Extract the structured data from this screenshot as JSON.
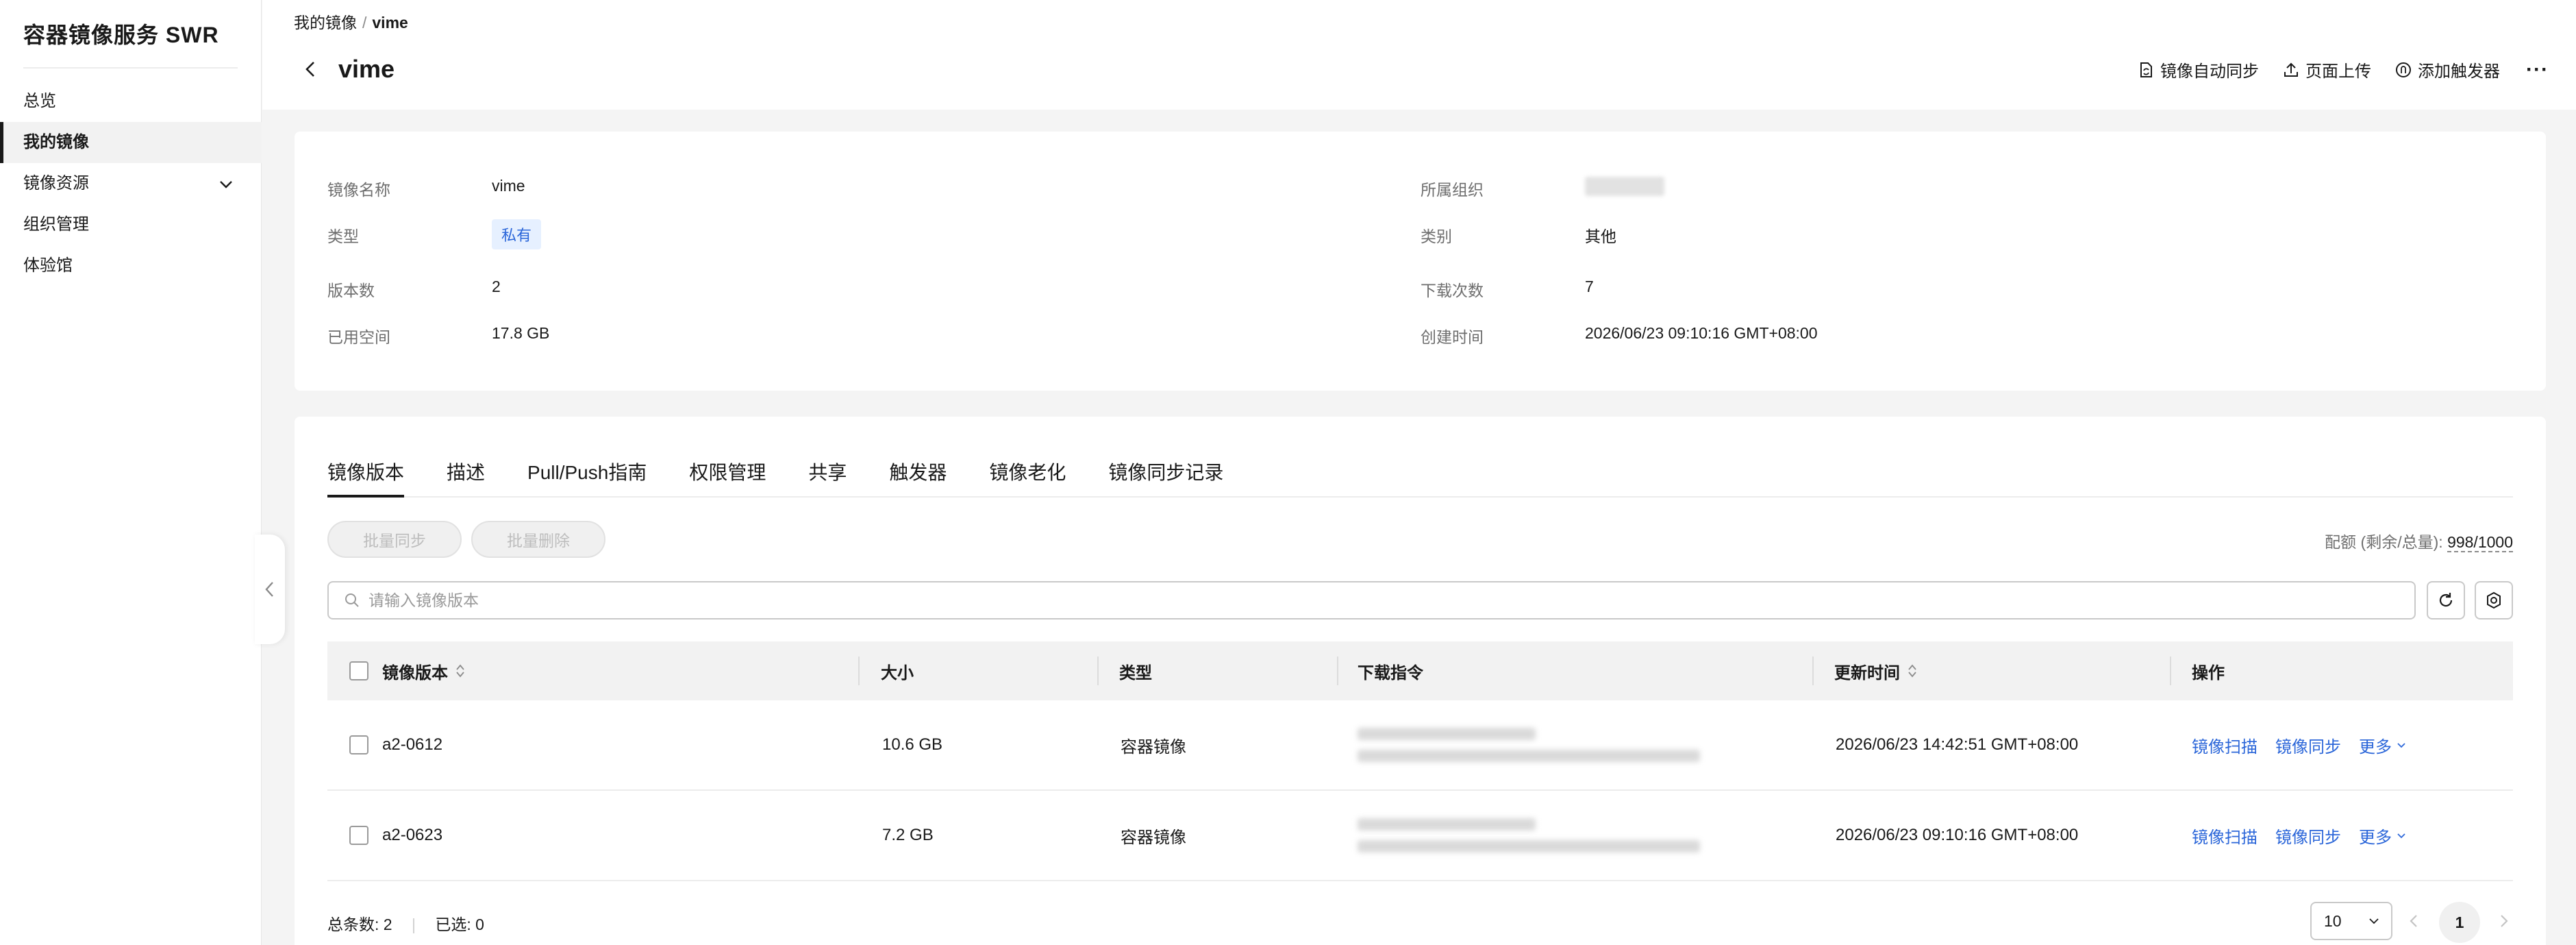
{
  "sidebar": {
    "title": "容器镜像服务 SWR",
    "items": [
      {
        "label": "总览"
      },
      {
        "label": "我的镜像"
      },
      {
        "label": "镜像资源"
      },
      {
        "label": "组织管理"
      },
      {
        "label": "体验馆"
      }
    ]
  },
  "header": {
    "breadcrumb": {
      "parent": "我的镜像",
      "separator": "/",
      "current": "vime"
    },
    "title": "vime",
    "actions": [
      {
        "label": "镜像自动同步",
        "icon": "sync-doc-icon"
      },
      {
        "label": "页面上传",
        "icon": "upload-icon"
      },
      {
        "label": "添加触发器",
        "icon": "trigger-icon"
      }
    ],
    "more": "···"
  },
  "info": {
    "name_label": "镜像名称",
    "name_value": "vime",
    "type_label": "类型",
    "type_value": "私有",
    "versions_label": "版本数",
    "versions_value": "2",
    "space_label": "已用空间",
    "space_value": "17.8 GB",
    "org_label": "所属组织",
    "category_label": "类别",
    "category_value": "其他",
    "downloads_label": "下载次数",
    "downloads_value": "7",
    "created_label": "创建时间",
    "created_value": "2026/06/23 09:10:16 GMT+08:00"
  },
  "tabs": [
    {
      "label": "镜像版本"
    },
    {
      "label": "描述"
    },
    {
      "label": "Pull/Push指南"
    },
    {
      "label": "权限管理"
    },
    {
      "label": "共享"
    },
    {
      "label": "触发器"
    },
    {
      "label": "镜像老化"
    },
    {
      "label": "镜像同步记录"
    }
  ],
  "toolbar": {
    "batch_sync": "批量同步",
    "batch_delete": "批量删除",
    "quota_label": "配额 (剩余/总量):",
    "quota_value": "998/1000",
    "search_placeholder": "请输入镜像版本"
  },
  "table": {
    "columns": {
      "version": "镜像版本",
      "size": "大小",
      "type": "类型",
      "command": "下载指令",
      "updated": "更新时间",
      "actions": "操作"
    },
    "rows": [
      {
        "version": "a2-0612",
        "size": "10.6 GB",
        "type": "容器镜像",
        "updated": "2026/06/23 14:42:51 GMT+08:00",
        "scan": "镜像扫描",
        "sync": "镜像同步",
        "more": "更多"
      },
      {
        "version": "a2-0623",
        "size": "7.2 GB",
        "type": "容器镜像",
        "updated": "2026/06/23 09:10:16 GMT+08:00",
        "scan": "镜像扫描",
        "sync": "镜像同步",
        "more": "更多"
      }
    ]
  },
  "footer": {
    "total_label": "总条数:",
    "total_value": "2",
    "selected_label": "已选:",
    "selected_value": "0",
    "page_size": "10",
    "current_page": "1"
  },
  "colors": {
    "accent": "#2b66d9",
    "tag_bg": "#e6f0ff",
    "page_bg": "#f4f4f4"
  }
}
